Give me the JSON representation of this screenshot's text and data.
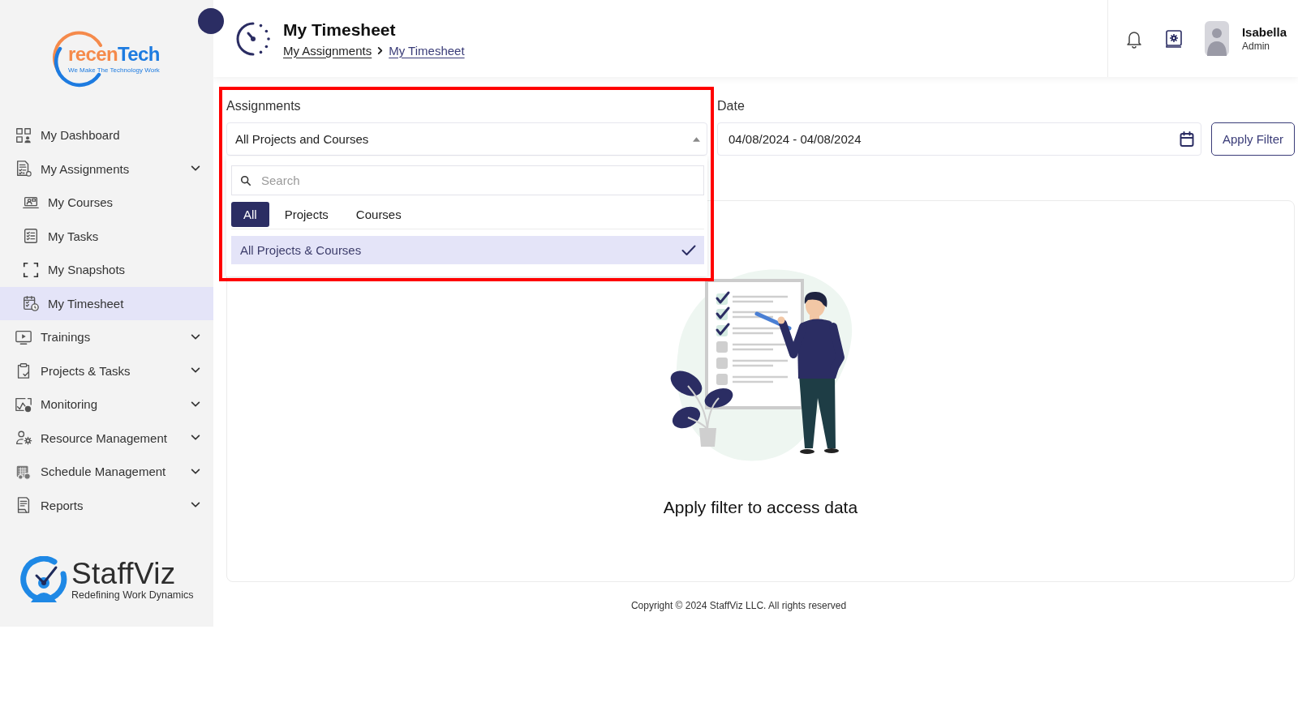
{
  "sidebar": {
    "logo": {
      "wordmark": [
        "recen",
        "Tech"
      ],
      "tagline": "We Make The Technology Work"
    },
    "items": [
      {
        "label": "My Dashboard",
        "has_submenu": false,
        "selected": false
      },
      {
        "label": "My Assignments",
        "has_submenu": true,
        "selected": false,
        "children": [
          {
            "label": "My Courses",
            "selected": false
          },
          {
            "label": "My Tasks",
            "selected": false
          },
          {
            "label": "My Snapshots",
            "selected": false
          },
          {
            "label": "My Timesheet",
            "selected": true
          }
        ]
      },
      {
        "label": "Trainings",
        "has_submenu": true,
        "selected": false
      },
      {
        "label": "Projects & Tasks",
        "has_submenu": true,
        "selected": false
      },
      {
        "label": "Monitoring",
        "has_submenu": true,
        "selected": false
      },
      {
        "label": "Resource Management",
        "has_submenu": true,
        "selected": false
      },
      {
        "label": "Schedule Management",
        "has_submenu": true,
        "selected": false
      },
      {
        "label": "Reports",
        "has_submenu": true,
        "selected": false
      }
    ],
    "brand": {
      "name": "StaffViz",
      "tagline": "Redefining Work Dynamics"
    }
  },
  "header": {
    "title": "My Timesheet",
    "breadcrumb": [
      {
        "label": "My Assignments",
        "current": false
      },
      {
        "label": "My Timesheet",
        "current": true
      }
    ],
    "user": {
      "name": "Isabella",
      "role": "Admin"
    }
  },
  "filters": [
    {
      "kind": "select",
      "label": "Assignments",
      "value": "All Projects and Courses",
      "open": true,
      "highlighted": true,
      "dropdown": {
        "search": {
          "placeholder": "Search"
        },
        "tabs": [
          {
            "label": "All",
            "selected": true
          },
          {
            "label": "Projects",
            "selected": false
          },
          {
            "label": "Courses",
            "selected": false
          }
        ],
        "options": [
          {
            "label": "All Projects & Courses",
            "selected": true
          }
        ]
      }
    },
    {
      "kind": "date_range",
      "label": "Date",
      "value": "04/08/2024 - 04/08/2024"
    }
  ],
  "apply_button": {
    "label": "Apply Filter"
  },
  "empty_state": {
    "message": "Apply filter to access data"
  },
  "footer": {
    "copyright": "Copyright © 2024 StaffViz LLC. All rights reserved"
  }
}
